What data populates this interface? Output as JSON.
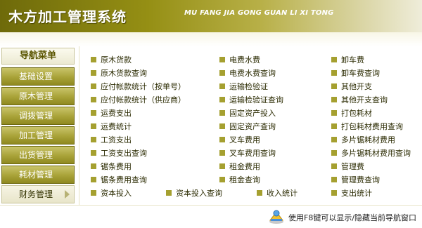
{
  "header": {
    "title": "木方加工管理系统",
    "subtitle": "MU FANG JIA GONG GUAN LI XI TONG"
  },
  "sidebar": {
    "header": "导航菜单",
    "items": [
      {
        "label": "基础设置"
      },
      {
        "label": "原木管理"
      },
      {
        "label": "调拨管理"
      },
      {
        "label": "加工管理"
      },
      {
        "label": "出货管理"
      },
      {
        "label": "耗材管理"
      },
      {
        "label": "财务管理"
      }
    ],
    "active_index": 6
  },
  "menu": {
    "col1": [
      "原木货款",
      "原木货款查询",
      "应付帐款统计（按单号）",
      "应付帐款统计（供应商）",
      "运费支出",
      "运费统计",
      "工资支出",
      "工资支出查询",
      "锯条费用",
      "锯条费用查询"
    ],
    "col2": [
      "电费水费",
      "电费水费查询",
      "运输检验证",
      "运输检验证查询",
      "固定资产投入",
      "固定资产查询",
      "叉车费用",
      "叉车费用查询",
      "租金费用",
      "租金查询"
    ],
    "col3": [
      "卸车费",
      "卸车费查询",
      "其他开支",
      "其他开支查询",
      "打包耗材",
      "打包耗材费用查询",
      "多片锯耗材费用",
      "多片锯耗材费用查询",
      "管理费",
      "管理费查询"
    ],
    "last_row": [
      "资本投入",
      "资本投入查询",
      "收入统计",
      "支出统计"
    ]
  },
  "status": {
    "text": "使用F8键可以显示/隐藏当前导航窗口"
  },
  "colors": {
    "header_dark": "#6e6a0a",
    "nav_olive": "#a8a238",
    "bullet": "#a5a030"
  }
}
